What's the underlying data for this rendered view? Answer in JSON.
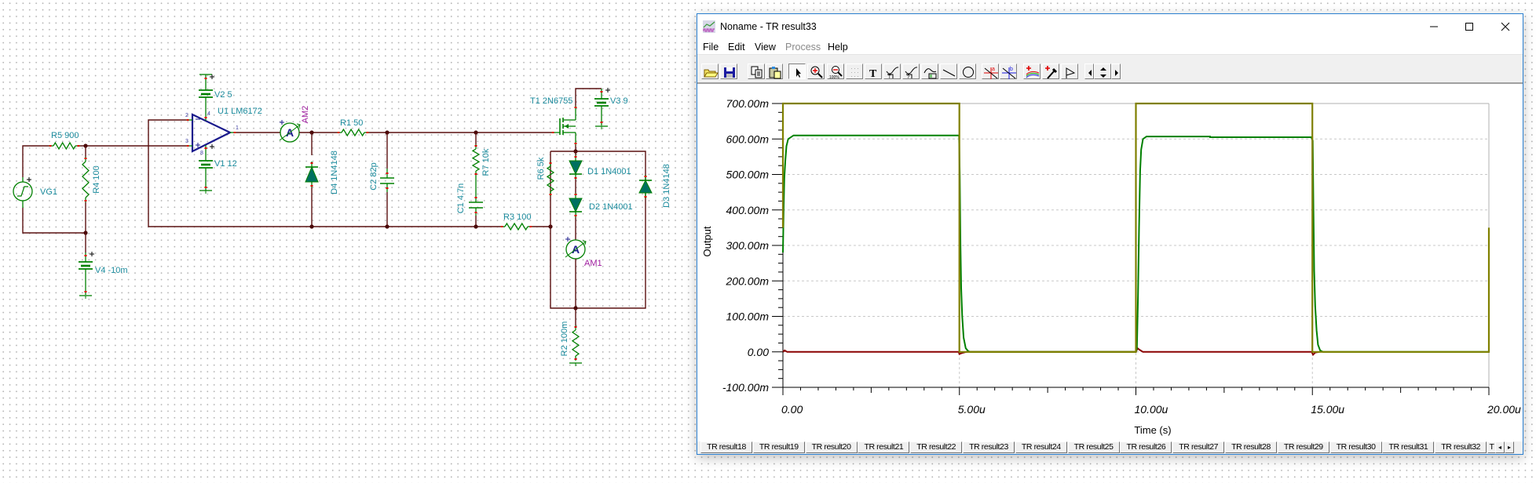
{
  "schematic": {
    "labels": {
      "vg1": "VG1",
      "r5": "R5 900",
      "r4": "R4 100",
      "v4": "V4 -10m",
      "v2": "V2 5",
      "u1": "U1 LM6172",
      "v1": "V1 12",
      "am2": "AM2",
      "d4": "D4 1N4148",
      "r1": "R1 50",
      "c2": "C2 82p",
      "c1": "C1 4.7n",
      "r7": "R7 10k",
      "r3": "R3 100",
      "t1": "T1 2N6755",
      "v3": "V3 9",
      "r6": "R6 5k",
      "d1": "D1 1N4001",
      "d2": "D2 1N4001",
      "am1": "AM1",
      "d3": "D3 1N4148",
      "r2": "R2 100m"
    },
    "pins": {
      "inv": "2",
      "noninv": "3",
      "out": "1",
      "vplus": "4",
      "vminus": "8"
    },
    "ammeter_glyph": "A",
    "colors": {
      "wire": "#5a1010",
      "component": "#008000",
      "label": "#1a8a9c",
      "meter_label": "#a020a0",
      "opamp": "#1a1a8c"
    }
  },
  "window": {
    "title": "Noname - TR result33",
    "menu": [
      {
        "label": "File",
        "enabled": true
      },
      {
        "label": "Edit",
        "enabled": true
      },
      {
        "label": "View",
        "enabled": true
      },
      {
        "label": "Process",
        "enabled": false
      },
      {
        "label": "Help",
        "enabled": true
      }
    ],
    "toolbar": [
      "open-folder-icon",
      "save-icon",
      "copy-icon",
      "paste-icon",
      "pointer-icon",
      "zoom-in-icon",
      "zoom-100-icon",
      "grid-icon",
      "text-icon",
      "annotate-text-icon",
      "annotate-question-icon",
      "annotate-legend-icon",
      "line-icon",
      "circle-icon",
      "cursor-a-icon",
      "cursor-b-icon",
      "add-trace-icon",
      "probe-icon",
      "flag-icon",
      "scroll-left-icon",
      "scroll-up-down-icon",
      "scroll-right-icon"
    ],
    "active_tool": "pointer-icon",
    "tabs": [
      "TR result18",
      "TR result19",
      "TR result20",
      "TR result21",
      "TR result22",
      "TR result23",
      "TR result24",
      "TR result25",
      "TR result26",
      "TR result27",
      "TR result28",
      "TR result29",
      "TR result30",
      "TR result31",
      "TR result32"
    ],
    "partial_tab": "T"
  },
  "chart_data": {
    "type": "line",
    "xlabel": "Time (s)",
    "ylabel": "Output",
    "xlim": [
      0,
      2e-05
    ],
    "ylim": [
      -0.1,
      0.7
    ],
    "x_ticks": [
      {
        "v": 0,
        "label": "0.00"
      },
      {
        "v": 5e-06,
        "label": "5.00u"
      },
      {
        "v": 1e-05,
        "label": "10.00u"
      },
      {
        "v": 1.5e-05,
        "label": "15.00u"
      },
      {
        "v": 2e-05,
        "label": "20.00u"
      }
    ],
    "y_ticks": [
      {
        "v": 0.7,
        "label": "700.00m"
      },
      {
        "v": 0.6,
        "label": "600.00m"
      },
      {
        "v": 0.5,
        "label": "500.00m"
      },
      {
        "v": 0.4,
        "label": "400.00m"
      },
      {
        "v": 0.3,
        "label": "300.00m"
      },
      {
        "v": 0.2,
        "label": "200.00m"
      },
      {
        "v": 0.1,
        "label": "100.00m"
      },
      {
        "v": 0,
        "label": "0.00"
      },
      {
        "v": -0.1,
        "label": "-100.00m"
      }
    ],
    "grid": true,
    "series": [
      {
        "color": "#8a0000",
        "x_unit": "us",
        "points": [
          [
            0,
            0
          ],
          [
            0.05,
            0.004
          ],
          [
            0.12,
            0
          ],
          [
            4.98,
            0
          ],
          [
            5.0,
            -0.006
          ],
          [
            5.08,
            -0.003
          ],
          [
            5.2,
            0
          ],
          [
            10.0,
            0
          ],
          [
            10.05,
            0.01
          ],
          [
            10.1,
            0.006
          ],
          [
            10.2,
            0
          ],
          [
            14.98,
            0
          ],
          [
            15.02,
            -0.008
          ],
          [
            15.08,
            -0.002
          ],
          [
            15.2,
            0
          ]
        ]
      },
      {
        "color": "#008000",
        "x_unit": "us",
        "points": [
          [
            0,
            0.28
          ],
          [
            0.02,
            0.4
          ],
          [
            0.04,
            0.49
          ],
          [
            0.07,
            0.54
          ],
          [
            0.1,
            0.58
          ],
          [
            0.15,
            0.6
          ],
          [
            0.3,
            0.61
          ],
          [
            4.99,
            0.61
          ],
          [
            5.01,
            0.5
          ],
          [
            5.03,
            0.3
          ],
          [
            5.05,
            0.18
          ],
          [
            5.08,
            0.1
          ],
          [
            5.12,
            0.04
          ],
          [
            5.18,
            0.01
          ],
          [
            5.25,
            0.002
          ],
          [
            5.3,
            0
          ],
          [
            10.0,
            0
          ],
          [
            10.03,
            0.01
          ],
          [
            10.06,
            0.16
          ],
          [
            10.09,
            0.35
          ],
          [
            10.12,
            0.51
          ],
          [
            10.15,
            0.57
          ],
          [
            10.2,
            0.6
          ],
          [
            10.3,
            0.607
          ],
          [
            12.1,
            0.607
          ],
          [
            12.1,
            0.605
          ],
          [
            14.97,
            0.605
          ],
          [
            15.01,
            0.595
          ],
          [
            15.03,
            0.4
          ],
          [
            15.05,
            0.23
          ],
          [
            15.08,
            0.13
          ],
          [
            15.12,
            0.06
          ],
          [
            15.16,
            0.02
          ],
          [
            15.22,
            0.004
          ],
          [
            15.3,
            0
          ],
          [
            20,
            0
          ]
        ]
      },
      {
        "color": "#808000",
        "x_unit": "us",
        "points": [
          [
            0,
            0.35
          ],
          [
            0,
            0.7
          ],
          [
            5,
            0.7
          ],
          [
            5,
            0
          ],
          [
            10,
            0
          ],
          [
            10,
            0.7
          ],
          [
            15,
            0.7
          ],
          [
            15,
            0
          ],
          [
            20,
            0
          ],
          [
            20,
            0.35
          ]
        ]
      }
    ]
  }
}
